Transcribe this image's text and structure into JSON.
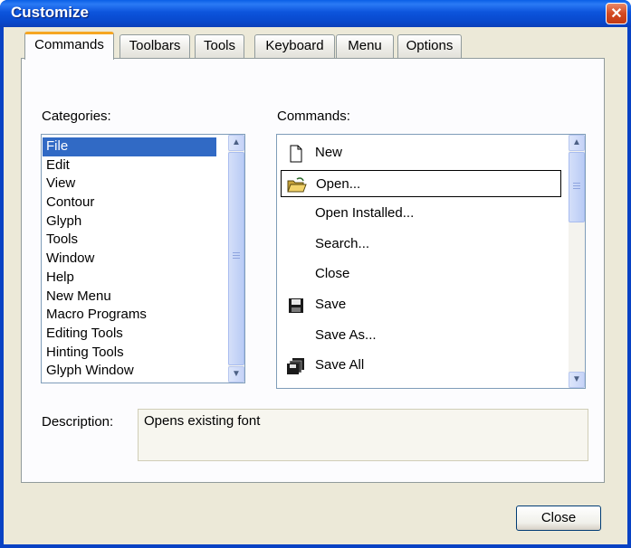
{
  "window": {
    "title": "Customize",
    "close_glyph": "✕"
  },
  "tabs": [
    {
      "label": "Commands",
      "active": true
    },
    {
      "label": "Toolbars",
      "active": false
    },
    {
      "label": "Tools",
      "active": false
    },
    {
      "label": "Keyboard",
      "active": false
    },
    {
      "label": "Menu",
      "active": false
    },
    {
      "label": "Options",
      "active": false
    }
  ],
  "categories": {
    "label": "Categories:",
    "selected": "File",
    "items": [
      "File",
      "Edit",
      "View",
      "Contour",
      "Glyph",
      "Tools",
      "Window",
      "Help",
      "New Menu",
      "Macro Programs",
      "Editing Tools",
      "Hinting Tools",
      "Glyph Window"
    ]
  },
  "commands": {
    "label": "Commands:",
    "focused": "Open...",
    "items": [
      {
        "label": "New",
        "icon": "new-document-icon"
      },
      {
        "label": "Open...",
        "icon": "open-folder-icon"
      },
      {
        "label": "Open Installed...",
        "icon": ""
      },
      {
        "label": "Search...",
        "icon": ""
      },
      {
        "label": "Close",
        "icon": ""
      },
      {
        "label": "Save",
        "icon": "floppy-disk-icon"
      },
      {
        "label": "Save As...",
        "icon": ""
      },
      {
        "label": "Save All",
        "icon": "save-all-icon"
      }
    ]
  },
  "description": {
    "label": "Description:",
    "text": "Opens existing font"
  },
  "footer": {
    "close_label": "Close"
  },
  "scroll": {
    "up_glyph": "▲",
    "down_glyph": "▼"
  },
  "colors": {
    "titlebar": "#0a54dc",
    "selection": "#316ac5",
    "active_tab_accent": "#f5a623"
  }
}
